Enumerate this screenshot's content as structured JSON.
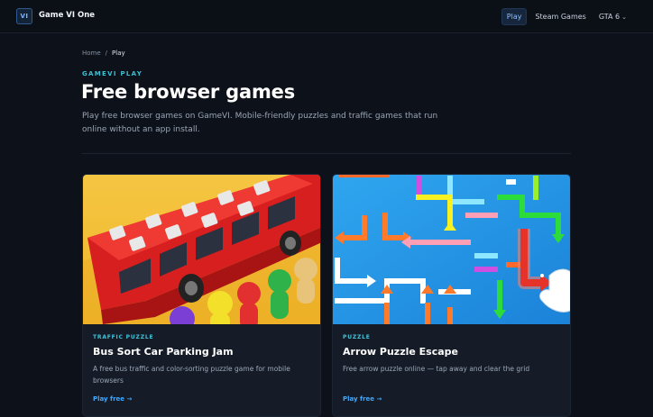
{
  "header": {
    "logo_text": "VI",
    "brand": "Game VI One",
    "nav": [
      {
        "label": "Play",
        "active": true
      },
      {
        "label": "Steam Games",
        "active": false
      },
      {
        "label": "GTA 6",
        "active": false,
        "dropdown": true
      }
    ]
  },
  "breadcrumb": {
    "home": "Home",
    "separator": "/",
    "current": "Play"
  },
  "hero": {
    "eyebrow": "GAMEVI PLAY",
    "title": "Free browser games",
    "description": "Play free browser games on GameVI. Mobile-friendly puzzles and traffic games that run online without an app install."
  },
  "cards": [
    {
      "tag": "TRAFFIC PUZZLE",
      "title": "Bus Sort Car Parking Jam",
      "description": "A free bus traffic and color-sorting puzzle game for mobile browsers",
      "link": "Play free →"
    },
    {
      "tag": "PUZZLE",
      "title": "Arrow Puzzle Escape",
      "description": "Free arrow puzzle online — tap away and clear the grid",
      "link": "Play free →"
    }
  ],
  "colors": {
    "background": "#0d1119",
    "accent_cyan": "#37c2d6",
    "link_blue": "#3fa9ff",
    "card_bg": "#151c28"
  }
}
